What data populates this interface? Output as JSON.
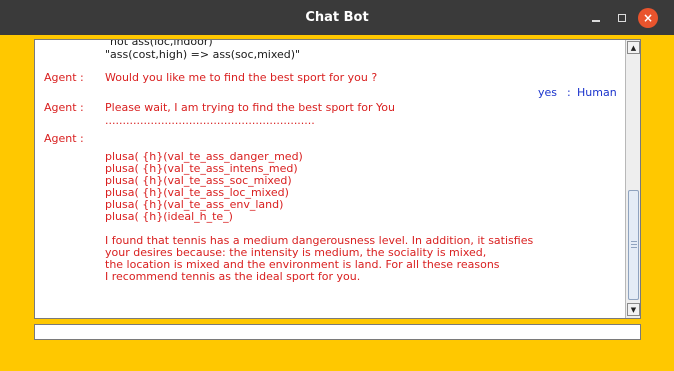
{
  "window": {
    "title": "Chat Bot",
    "close_glyph": "×"
  },
  "chat": {
    "lines": [
      {
        "speaker": "",
        "text": "\"not ass(loc,indoor)\"",
        "color": "black"
      },
      {
        "speaker": "",
        "text": "\"ass(cost,high) => ass(soc,mixed)\"",
        "color": "black"
      },
      {
        "speaker": "Agent :",
        "text": "Would you like me to find the best sport for you ?",
        "color": "red"
      },
      {
        "speaker": "Human",
        "text": "yes",
        "color": "blue"
      },
      {
        "speaker": "Agent :",
        "text": "Please wait, I am trying to find the best sport for You",
        "color": "red"
      },
      {
        "speaker": "",
        "text": "............................................................",
        "color": "red"
      },
      {
        "speaker": "Agent :",
        "text": "",
        "color": "red"
      },
      {
        "speaker": "",
        "text": "plusa( {h}(val_te_ass_danger_med)",
        "color": "red"
      },
      {
        "speaker": "",
        "text": "plusa( {h}(val_te_ass_intens_med)",
        "color": "red"
      },
      {
        "speaker": "",
        "text": "plusa( {h}(val_te_ass_soc_mixed)",
        "color": "red"
      },
      {
        "speaker": "",
        "text": "plusa( {h}(val_te_ass_loc_mixed)",
        "color": "red"
      },
      {
        "speaker": "",
        "text": "plusa( {h}(val_te_ass_env_land)",
        "color": "red"
      },
      {
        "speaker": "",
        "text": "plusa( {h}(ideal_h_te_)",
        "color": "red"
      },
      {
        "speaker": "",
        "text": "I found that tennis has a medium dangerousness level. In addition, it satisfies",
        "color": "red"
      },
      {
        "speaker": "",
        "text": "your desires because: the intensity is medium, the sociality is mixed,",
        "color": "red"
      },
      {
        "speaker": "",
        "text": "the location is mixed and the environment is land. For all these reasons",
        "color": "red"
      },
      {
        "speaker": "",
        "text": "I recommend tennis as the ideal sport for you.",
        "color": "red"
      }
    ]
  },
  "colors": {
    "window_bg": "#ffc800",
    "titlebar": "#3a3a3a",
    "agent_text": "#d92020",
    "human_text": "#1a33cc",
    "close_button": "#e9542d"
  },
  "input": {
    "value": ""
  }
}
